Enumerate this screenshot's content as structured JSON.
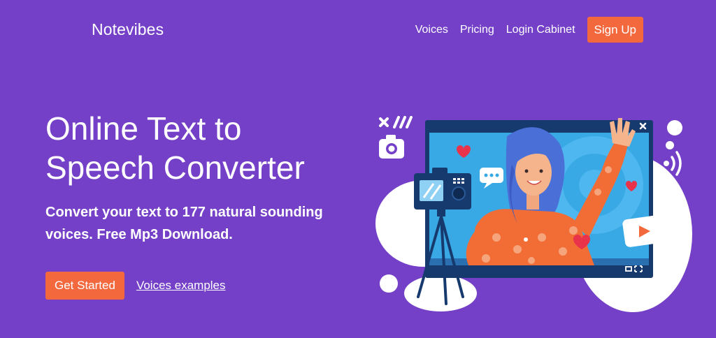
{
  "header": {
    "brand": "Notevibes",
    "nav": [
      {
        "label": "Voices"
      },
      {
        "label": "Pricing"
      },
      {
        "label": "Login Cabinet"
      }
    ],
    "signup_label": "Sign Up"
  },
  "hero": {
    "title_line1": "Online Text to",
    "title_line2": "Speech Converter",
    "subtitle_line1": "Convert your text to 177 natural sounding",
    "subtitle_line2": "voices. Free Mp3 Download.",
    "cta_label": "Get Started",
    "link_label": "Voices examples"
  },
  "illustration": {
    "icons": [
      "close-icon",
      "camera-icon",
      "speaker-waves-icon",
      "heart-icon",
      "chat-bubble-icon",
      "play-button-icon",
      "fullscreen-icon"
    ]
  },
  "colors": {
    "background": "#7540c8",
    "accent": "#f4683d",
    "screen_frame": "#173a6e",
    "screen_bg": "#39a9e6"
  }
}
